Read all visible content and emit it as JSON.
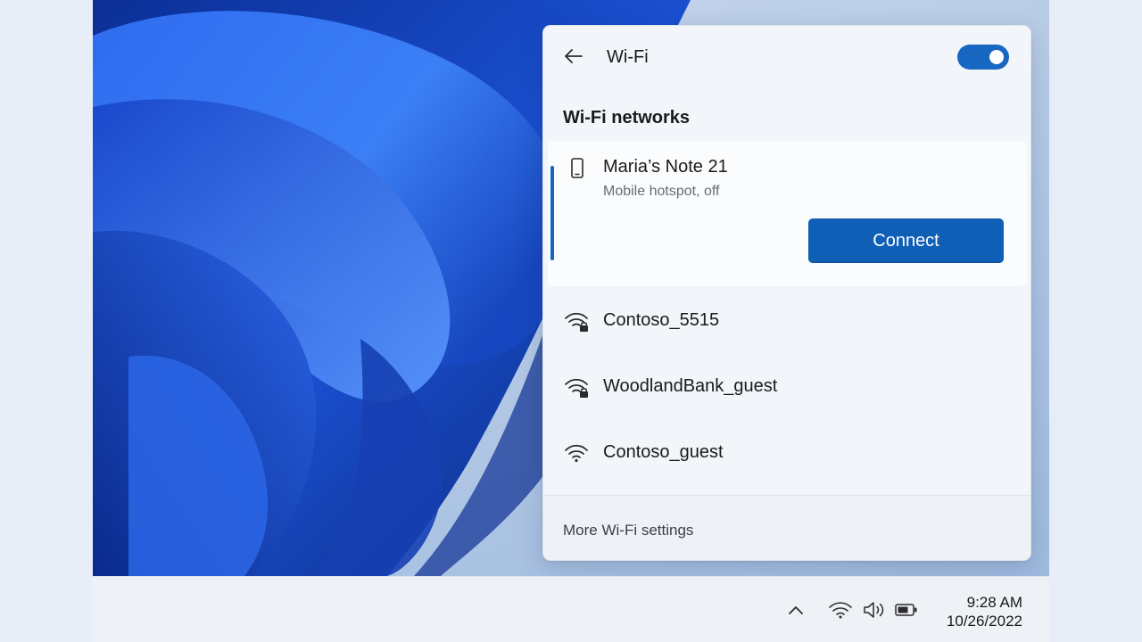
{
  "flyout": {
    "title": "Wi-Fi",
    "toggle_on": true,
    "section_title": "Wi-Fi networks",
    "selected_network": {
      "name": "Maria’s Note 21",
      "status": "Mobile hotspot, off",
      "icon": "phone-icon",
      "connect_label": "Connect"
    },
    "networks": [
      {
        "name": "Contoso_5515",
        "icon": "wifi-secured-icon"
      },
      {
        "name": "WoodlandBank_guest",
        "icon": "wifi-secured-icon"
      },
      {
        "name": "Contoso_guest",
        "icon": "wifi-icon"
      }
    ],
    "footer_link": "More Wi-Fi settings"
  },
  "taskbar": {
    "time": "9:28 AM",
    "date": "10/26/2022",
    "tray_icons": [
      "chevron-up-icon",
      "wifi-icon",
      "volume-icon",
      "battery-icon"
    ]
  },
  "colors": {
    "accent": "#1766c2",
    "button": "#0f5fb6",
    "wallpaper_dark": "#0a2a8c",
    "wallpaper_light": "#3f7ff0"
  }
}
